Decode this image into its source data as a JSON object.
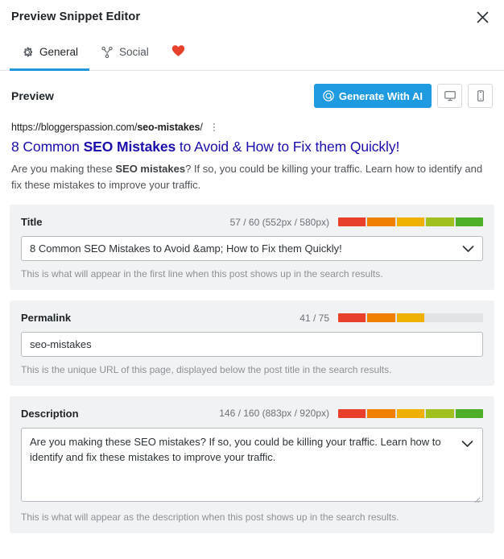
{
  "window": {
    "title": "Preview Snippet Editor",
    "close_icon": "close-icon"
  },
  "tabs": [
    {
      "label": "General",
      "icon": "gear-icon",
      "active": true
    },
    {
      "label": "Social",
      "icon": "share-nodes-icon",
      "active": false
    },
    {
      "label": "",
      "icon": "heart-icon",
      "active": false
    }
  ],
  "preview": {
    "label": "Preview",
    "generate_button": "Generate With AI",
    "generate_icon": "ai-sparkle-icon",
    "desktop_icon": "desktop-monitor-icon",
    "mobile_icon": "mobile-phone-icon",
    "url_prefix": "https://bloggerspassion.com/",
    "url_slug": "seo-mistakes",
    "url_suffix": "/",
    "kebab_icon": "more-vertical-icon",
    "title_pre": "8 Common ",
    "title_bold": "SEO Mistakes",
    "title_post": " to Avoid & How to Fix them Quickly!",
    "desc_pre": "Are you making these ",
    "desc_bold": "SEO mistakes",
    "desc_post": "? If so, you could be killing your traffic. Learn how to identify and fix these mistakes to improve your traffic."
  },
  "colors": {
    "accent": "#1e9ae0",
    "tab_underline": "#2196dd",
    "heart": "#e8402a",
    "link": "#1a0dab",
    "meter_track": "#e2e3e5",
    "meter_red": "#e8402a",
    "meter_orange": "#f08000",
    "meter_yellow": "#f0b000",
    "meter_yellowgreen": "#a0c020",
    "meter_green": "#4caf27"
  },
  "fields": [
    {
      "label": "Title",
      "count": "57 / 60 (552px / 580px)",
      "meter_segments": [
        "#e8402a",
        "#f08000",
        "#f0b000",
        "#a0c020",
        "#4caf27"
      ],
      "meter_filled": 5,
      "value": "8 Common SEO Mistakes to Avoid &amp; How to Fix them Quickly!",
      "help": "This is what will appear in the first line when this post shows up in the search results.",
      "chevron_icon": "chevron-down-icon"
    },
    {
      "label": "Permalink",
      "count": "41 / 75",
      "meter_segments": [
        "#e8402a",
        "#f08000",
        "#f0b000",
        "#e2e3e5",
        "#e2e3e5"
      ],
      "meter_filled": 3,
      "value": "seo-mistakes",
      "help": "This is the unique URL of this page, displayed below the post title in the search results.",
      "chevron_icon": ""
    },
    {
      "label": "Description",
      "count": "146 / 160 (883px / 920px)",
      "meter_segments": [
        "#e8402a",
        "#f08000",
        "#f0b000",
        "#a0c020",
        "#4caf27"
      ],
      "meter_filled": 5,
      "value": "Are you making these SEO mistakes? If so, you could be killing your traffic. Learn how to identify and fix these mistakes to improve your traffic.",
      "help": "This is what will appear as the description when this post shows up in the search results.",
      "chevron_icon": "chevron-down-icon"
    }
  ]
}
